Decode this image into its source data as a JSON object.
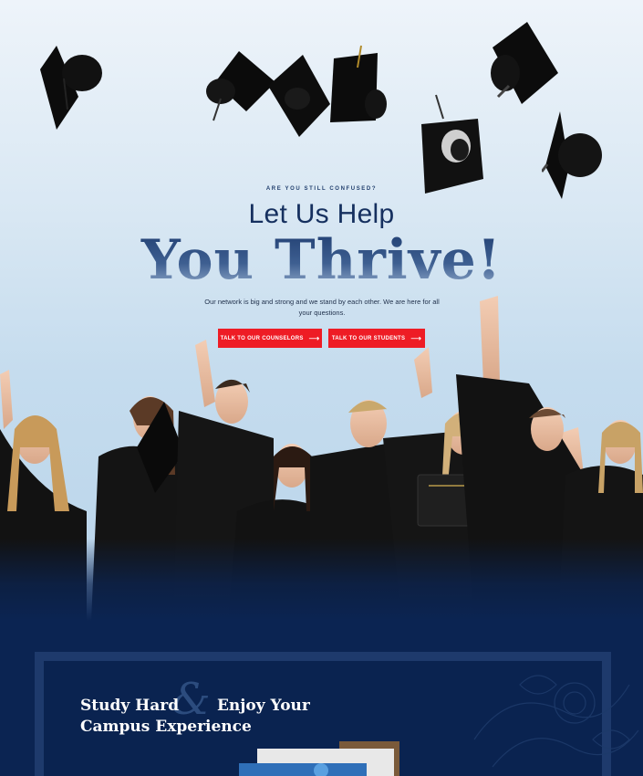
{
  "hero": {
    "eyebrow": "ARE YOU STILL CONFUSED?",
    "heading_line1": "Let Us Help",
    "heading_line2": "You Thrive!",
    "intro": "Our network is big and strong and we stand by each other. We are here for all your questions.",
    "buttons": [
      {
        "label": "TALK TO OUR COUNSELORS",
        "arrow": "⟶"
      },
      {
        "label": "TALK TO OUR STUDENTS",
        "arrow": "⟶"
      }
    ],
    "accent_color": "#ee1c25",
    "heading_color": "#16305f"
  },
  "feature": {
    "title_part1": "Study Hard",
    "ampersand": "&",
    "title_part2": "Enjoy Your",
    "title_line2": "Campus Experience",
    "background_color": "#0b2452"
  }
}
